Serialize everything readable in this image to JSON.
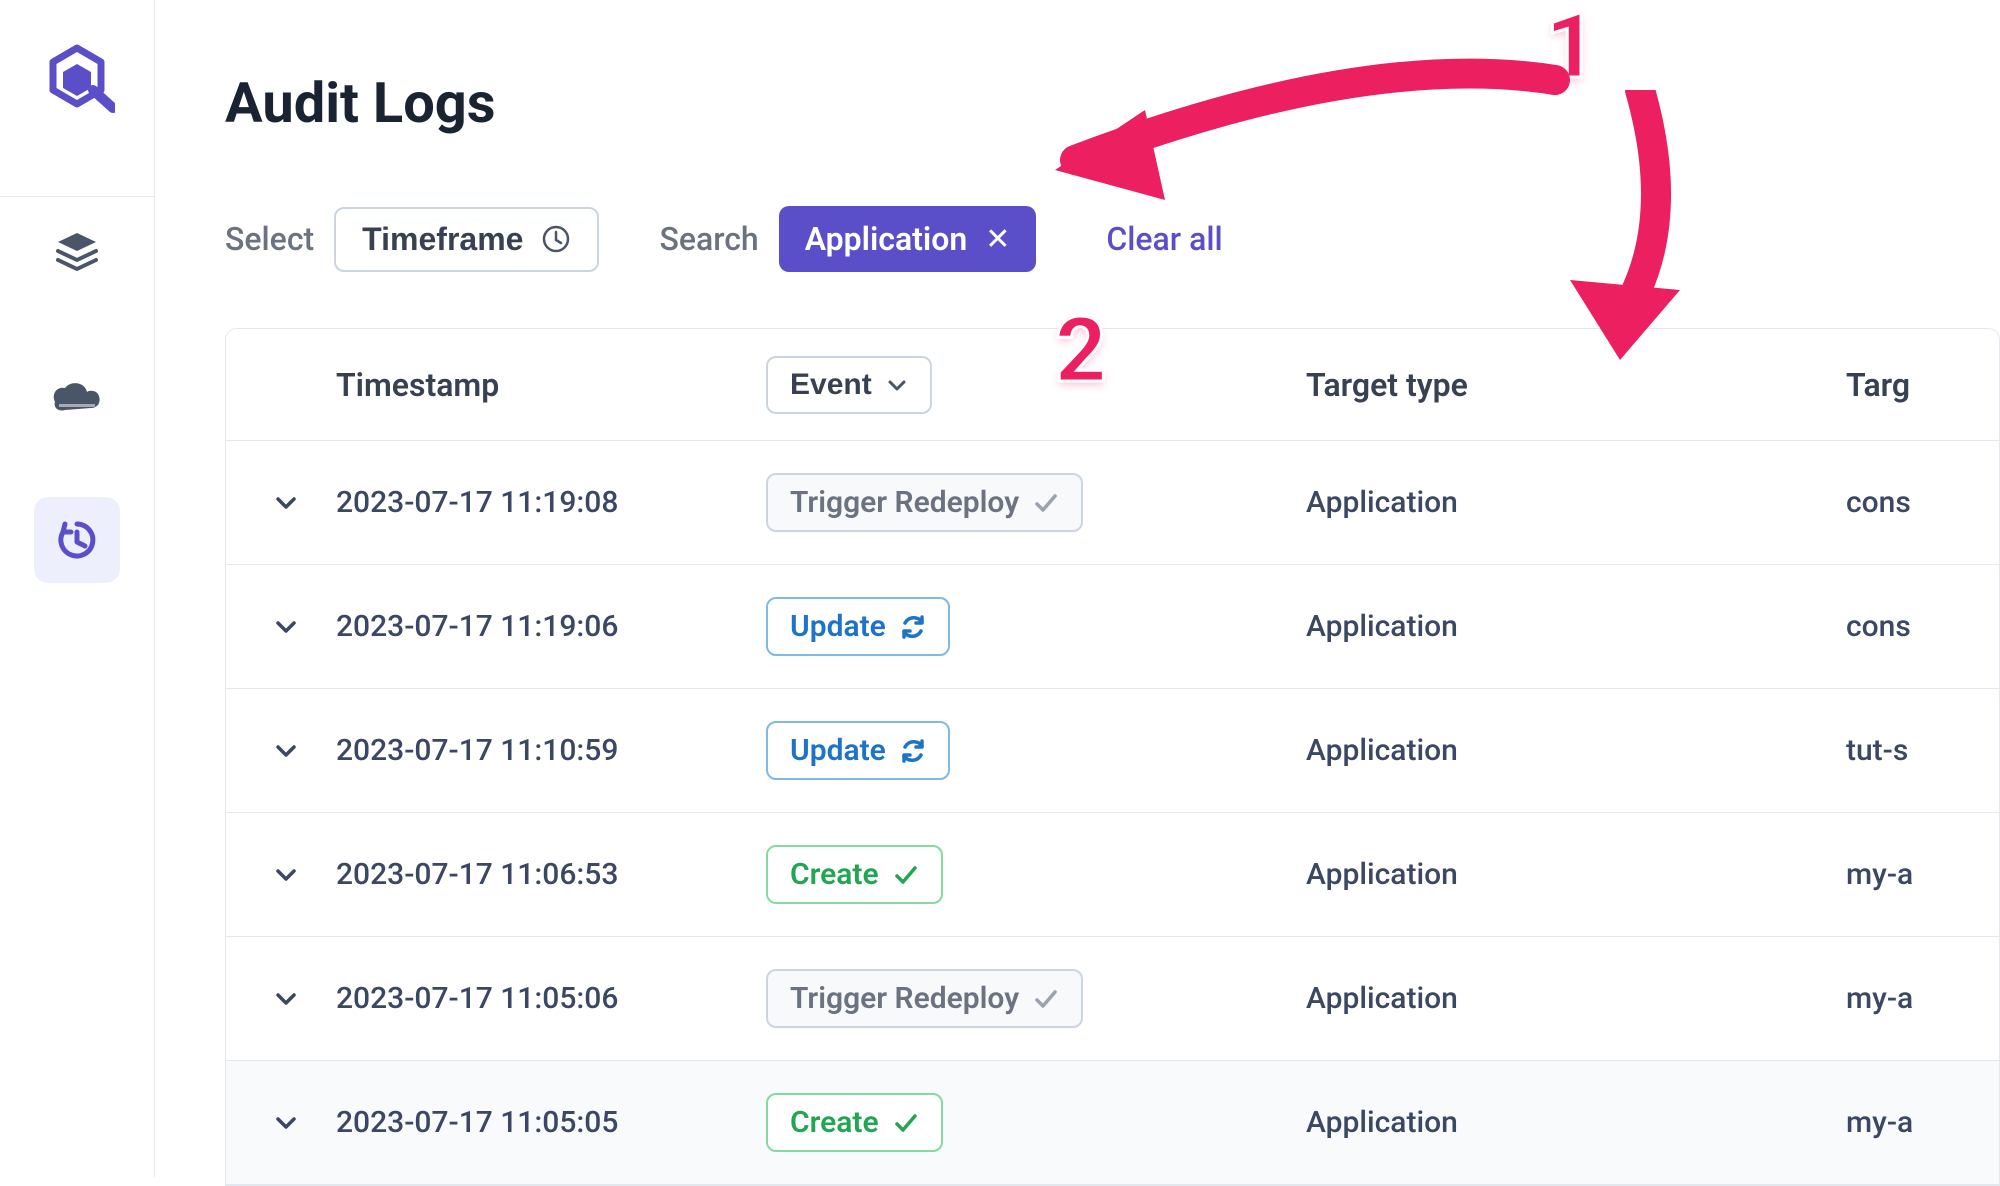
{
  "page": {
    "title": "Audit Logs"
  },
  "filters": {
    "select_label": "Select",
    "timeframe_label": "Timeframe",
    "search_label": "Search",
    "chip_label": "Application",
    "clear_all": "Clear all"
  },
  "table": {
    "headers": {
      "timestamp": "Timestamp",
      "event": "Event",
      "target_type": "Target type",
      "target": "Targ"
    },
    "rows": [
      {
        "timestamp": "2023-07-17 11:19:08",
        "event_label": "Trigger Redeploy",
        "event_kind": "trigger",
        "target_type": "Application",
        "target": "cons"
      },
      {
        "timestamp": "2023-07-17 11:19:06",
        "event_label": "Update",
        "event_kind": "update",
        "target_type": "Application",
        "target": "cons"
      },
      {
        "timestamp": "2023-07-17 11:10:59",
        "event_label": "Update",
        "event_kind": "update",
        "target_type": "Application",
        "target": "tut-s"
      },
      {
        "timestamp": "2023-07-17 11:06:53",
        "event_label": "Create",
        "event_kind": "create",
        "target_type": "Application",
        "target": "my-a"
      },
      {
        "timestamp": "2023-07-17 11:05:06",
        "event_label": "Trigger Redeploy",
        "event_kind": "trigger",
        "target_type": "Application",
        "target": "my-a"
      },
      {
        "timestamp": "2023-07-17 11:05:05",
        "event_label": "Create",
        "event_kind": "create",
        "target_type": "Application",
        "target": "my-a"
      }
    ]
  },
  "annotations": {
    "one": "1",
    "two": "2"
  }
}
